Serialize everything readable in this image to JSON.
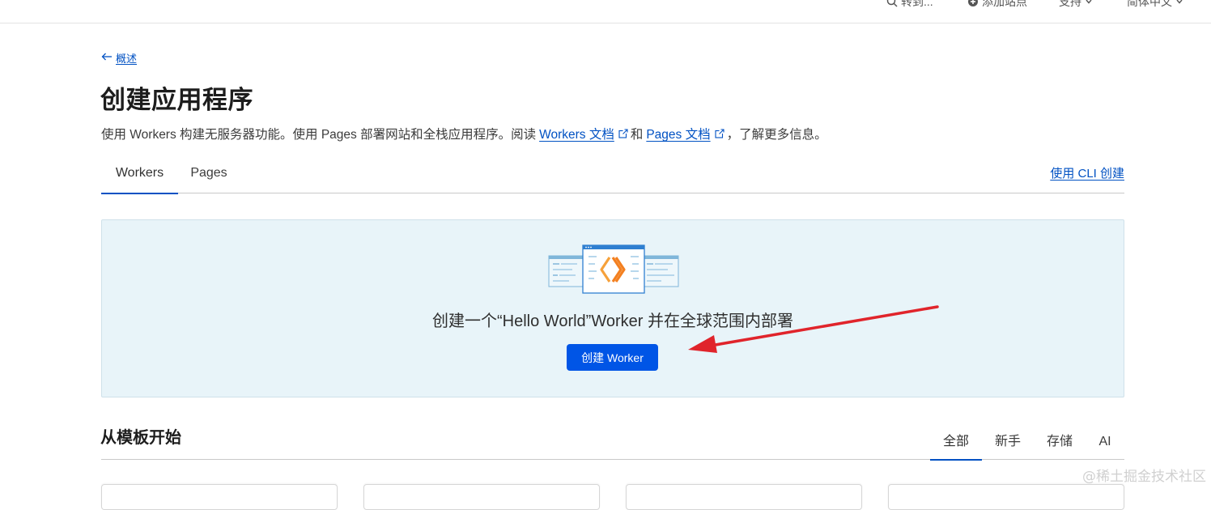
{
  "topbar": {
    "items": [
      {
        "label": "转到...",
        "icon": "search-icon"
      },
      {
        "label": "添加站点",
        "icon": "plus-circle-icon"
      },
      {
        "label": "支持",
        "icon": "chevron-down-icon"
      },
      {
        "label": "简体中文",
        "icon": "chevron-down-icon"
      }
    ]
  },
  "breadcrumb": {
    "back_label": "概述",
    "icon": "arrow-left-icon"
  },
  "page": {
    "title": "创建应用程序",
    "desc_prefix": "使用 Workers 构建无服务器功能。使用 Pages 部署网站和全栈应用程序。阅读",
    "workers_docs_link": "Workers 文档",
    "desc_and": "和",
    "pages_docs_link": "Pages 文档",
    "desc_suffix": "，了解更多信息。"
  },
  "tabs": [
    {
      "label": "Workers",
      "active": true
    },
    {
      "label": "Pages",
      "active": false
    }
  ],
  "cli_link": "使用 CLI 创建",
  "hero": {
    "text": "创建一个“Hello World”Worker 并在全球范围内部署",
    "button": "创建 Worker"
  },
  "templates": {
    "title": "从模板开始",
    "filters": [
      {
        "label": "全部",
        "active": true
      },
      {
        "label": "新手",
        "active": false
      },
      {
        "label": "存储",
        "active": false
      },
      {
        "label": "AI",
        "active": false
      }
    ]
  },
  "watermark": "@稀土掘金技术社区",
  "colors": {
    "accent": "#0051c3",
    "button": "#0055e6",
    "hero_bg": "#e8f4f9",
    "annotation_arrow": "#e0242b",
    "logo_orange": "#f38020"
  }
}
